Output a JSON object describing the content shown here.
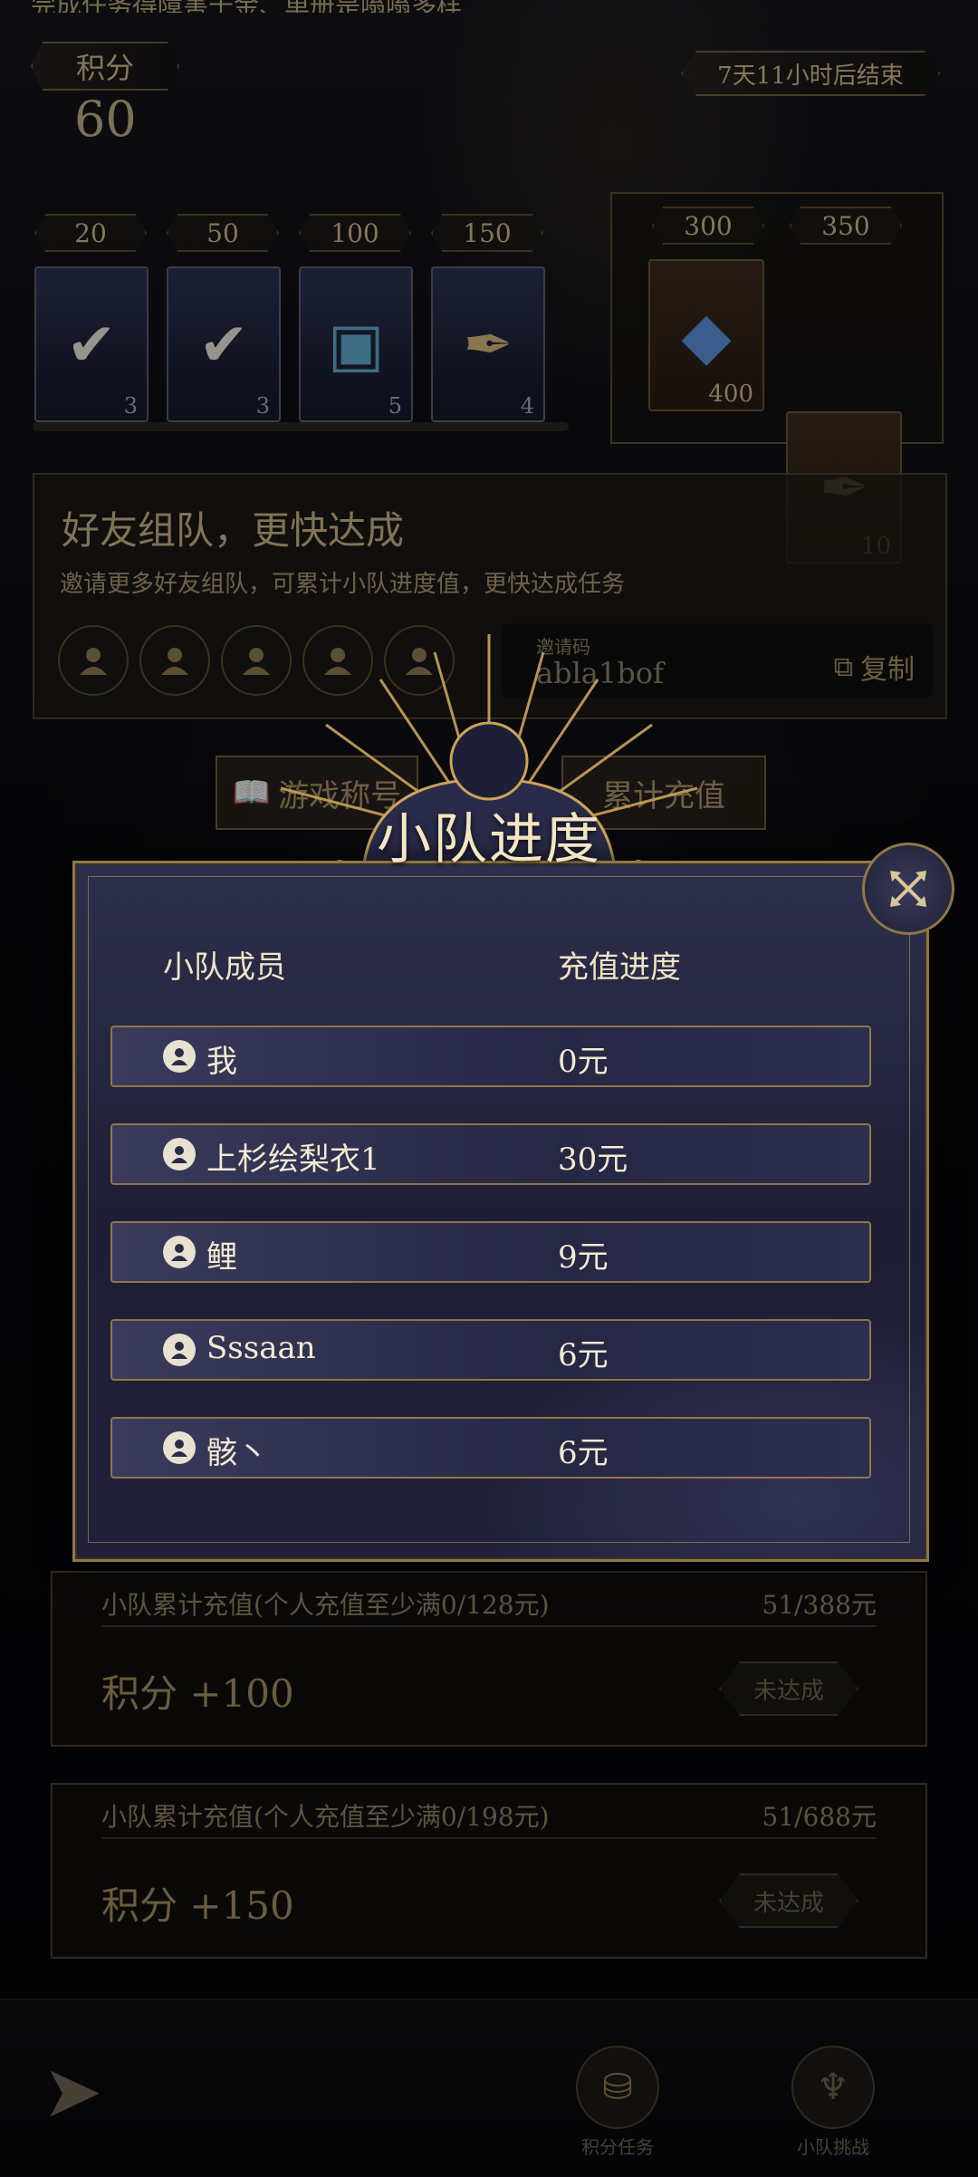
{
  "background": {
    "top_banner": "完成任务得障害千金、单册是嗡嗡多样",
    "score_label": "积分",
    "score_value": "60",
    "countdown": "7天11小时后结束",
    "rewards": [
      {
        "points": "20",
        "count": "3",
        "icon": "checkmark-icon"
      },
      {
        "points": "50",
        "count": "3",
        "icon": "checkmark-icon"
      },
      {
        "points": "100",
        "count": "5",
        "icon": "treasure-chest-icon"
      },
      {
        "points": "150",
        "count": "4",
        "icon": "feather-icon"
      }
    ],
    "premium_rewards": [
      {
        "points": "300",
        "count": "400",
        "icon": "gem-icon"
      },
      {
        "points": "350",
        "count": "10",
        "icon": "feather-icon"
      }
    ],
    "reward_progress": 0.0,
    "team": {
      "title": "好友组队，更快达成",
      "subtitle": "邀请更多好友组队，可累计小队进度值，更快达成任务",
      "invite_label": "邀请码",
      "invite_code": "abla1bof",
      "copy_label": "复制"
    },
    "buttons": {
      "game_button": "游戏称号",
      "recharge_button": "累计充值"
    },
    "tasks": [
      {
        "desc": "小队累计充值(个人充值至少满0/128元)",
        "progress": "51/388元",
        "points": "积分 +100",
        "status": "未达成"
      },
      {
        "desc": "小队累计充值(个人充值至少满0/198元)",
        "progress": "51/688元",
        "points": "积分 +150",
        "status": "未达成"
      }
    ],
    "nav": {
      "back_icon": "back-arrow-icon",
      "tab_points": "积分任务",
      "tab_team": "小队挑战"
    }
  },
  "modal": {
    "title": "小队进度",
    "col_member": "小队成员",
    "col_progress": "充值进度",
    "members": [
      {
        "name": "我",
        "amount": "0元"
      },
      {
        "name": "上杉绘梨衣1",
        "amount": "30元"
      },
      {
        "name": "鲤",
        "amount": "9元"
      },
      {
        "name": "Sssaan",
        "amount": "6元"
      },
      {
        "name": "骸丶",
        "amount": "6元"
      }
    ]
  },
  "colors": {
    "gold": "#8e7748",
    "modal_bg": "#1e1f36",
    "text_light": "#f3ead2"
  }
}
